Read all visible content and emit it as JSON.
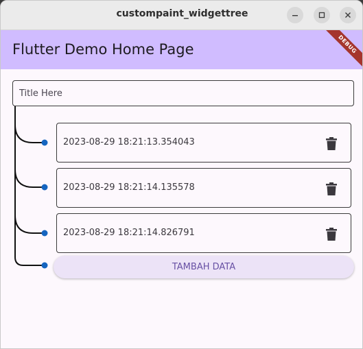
{
  "window": {
    "title": "custompaint_widgettree"
  },
  "appbar": {
    "title": "Flutter Demo Home Page",
    "debug_banner": "DEBUG",
    "color": "#d0bcff"
  },
  "form": {
    "title_placeholder": "Title Here",
    "title_value": ""
  },
  "items": [
    {
      "timestamp": "2023-08-29 18:21:13.354043"
    },
    {
      "timestamp": "2023-08-29 18:21:14.135578"
    },
    {
      "timestamp": "2023-08-29 18:21:14.826791"
    }
  ],
  "actions": {
    "add_label": "TAMBAH DATA"
  },
  "colors": {
    "node_dot": "#1565c0",
    "accent": "#6750a4"
  }
}
